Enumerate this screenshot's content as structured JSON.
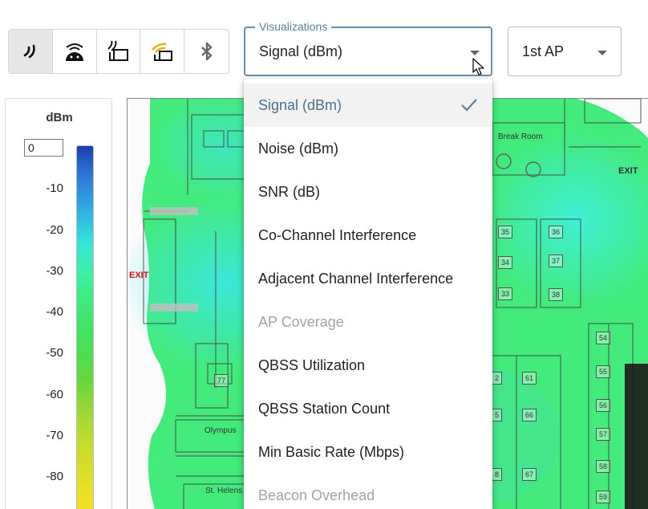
{
  "toolbar": {
    "buttons": [
      {
        "icon": "wifi-signal-icon",
        "active": true
      },
      {
        "icon": "android-survey-icon",
        "active": false
      },
      {
        "icon": "access-point-icon",
        "active": false
      },
      {
        "icon": "access-point-signal-icon",
        "active": false,
        "color": "#f0a500"
      },
      {
        "icon": "bluetooth-icon",
        "active": false
      }
    ]
  },
  "visualization_select": {
    "label": "Visualizations",
    "value": "Signal (dBm)"
  },
  "ap_select": {
    "value": "1st AP"
  },
  "legend": {
    "unit": "dBm",
    "input_value": "0",
    "ticks": [
      "-10",
      "-20",
      "-30",
      "-40",
      "-50",
      "-60",
      "-70",
      "-80"
    ]
  },
  "map": {
    "rooms": {
      "break_room": "Break Room",
      "olympus": "Olympus",
      "st_helens": "St. Helens"
    },
    "exit_label": "EXIT",
    "numbers": [
      "35",
      "36",
      "34",
      "37",
      "33",
      "38",
      "54",
      "55",
      "56",
      "57",
      "58",
      "59",
      "77",
      "61",
      "66",
      "67",
      "2",
      "5",
      "8"
    ]
  },
  "dropdown": {
    "items": [
      {
        "label": "Signal (dBm)",
        "state": "selected"
      },
      {
        "label": "Noise (dBm)",
        "state": "normal"
      },
      {
        "label": "SNR (dB)",
        "state": "normal"
      },
      {
        "label": "Co-Channel Interference",
        "state": "normal"
      },
      {
        "label": "Adjacent Channel Interference",
        "state": "normal"
      },
      {
        "label": "AP Coverage",
        "state": "disabled"
      },
      {
        "label": "QBSS Utilization",
        "state": "normal"
      },
      {
        "label": "QBSS Station Count",
        "state": "normal"
      },
      {
        "label": "Min Basic Rate (Mbps)",
        "state": "normal"
      },
      {
        "label": "Beacon Overhead",
        "state": "disabled"
      }
    ]
  },
  "colors": {
    "accent": "#5a7e9c",
    "heat_green": "#3fe97a",
    "heat_cyan": "#34e6d6",
    "exit_red": "#d01010"
  }
}
